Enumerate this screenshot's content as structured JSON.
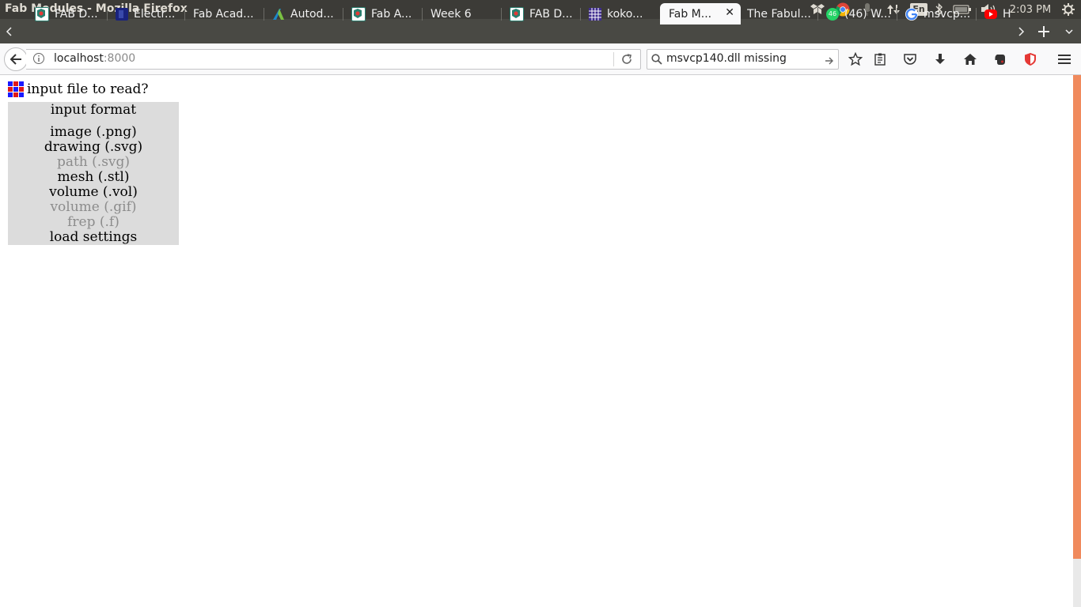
{
  "window": {
    "title": "Fab Modules - Mozilla Firefox"
  },
  "system_tray": {
    "keyboard_layout": "En",
    "clock": "2:03 PM"
  },
  "tabs": [
    {
      "label": "FAB D...",
      "favicon_color": "#2a7f6f"
    },
    {
      "label": "Electr...",
      "favicon_color": "#1a237e"
    },
    {
      "label": "Fab Acad...",
      "favicon_color": ""
    },
    {
      "label": "Autod...",
      "favicon_color": "#1c87c9"
    },
    {
      "label": "Fab A...",
      "favicon_color": "#2a7f6f"
    },
    {
      "label": "Week 6",
      "favicon_color": ""
    },
    {
      "label": "FAB D...",
      "favicon_color": "#2a7f6f"
    },
    {
      "label": "koko...",
      "favicon_color": "#3f2d8f"
    },
    {
      "label": "Fab M...",
      "favicon_color": "",
      "active": true
    },
    {
      "label": "The Fabul...",
      "favicon_color": ""
    },
    {
      "label": "(46) W...",
      "favicon_color": "#25d366",
      "badge": "46"
    },
    {
      "label": "msvcp...",
      "favicon_color": "#4285f4"
    },
    {
      "label": "H",
      "favicon_color": "#ff0000"
    }
  ],
  "navbar": {
    "url_host": "localhost",
    "url_port": ":8000",
    "search_query": "msvcp140.dll missing"
  },
  "page": {
    "prompt": "input file to read?",
    "menu": {
      "header": "input format",
      "items": [
        {
          "label": "image (.png)",
          "enabled": true
        },
        {
          "label": "drawing (.svg)",
          "enabled": true
        },
        {
          "label": "path (.svg)",
          "enabled": false
        },
        {
          "label": "mesh (.stl)",
          "enabled": true
        },
        {
          "label": "volume (.vol)",
          "enabled": true
        },
        {
          "label": "volume (.gif)",
          "enabled": false
        },
        {
          "label": "frep (.f)",
          "enabled": false
        },
        {
          "label": "load settings",
          "enabled": true
        }
      ]
    }
  },
  "colors": {
    "scrollbar_thumb": "#f08a5d",
    "menu_bg": "#dcdcdc",
    "disabled_text": "#8c8c8c"
  }
}
